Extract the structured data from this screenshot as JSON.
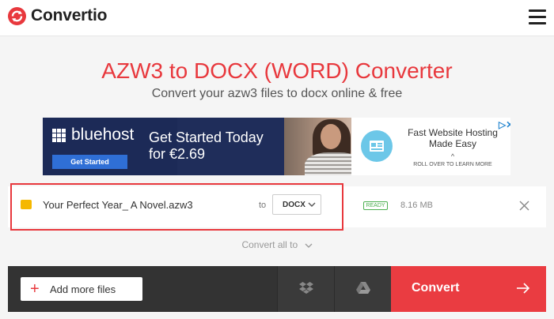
{
  "header": {
    "brand_name": "Convertio",
    "menu_icon": "hamburger-menu-icon"
  },
  "hero": {
    "title": "AZW3 to DOCX (WORD) Converter",
    "subtitle": "Convert your azw3 files to docx online & free"
  },
  "ad": {
    "brand": "bluehost",
    "button_label": "Get Started",
    "headline": "Get Started Today for €2.69",
    "right_text": "Fast Website Hosting Made Easy",
    "rollover_text": "ROLL OVER TO LEARN MORE",
    "adchoices_icon": "adchoices-icon"
  },
  "file": {
    "name": "Your Perfect Year_ A Novel.azw3",
    "to_label": "to",
    "target_format": "DOCX",
    "status": "READY",
    "size": "8.16 MB"
  },
  "convert_all_label": "Convert all to",
  "toolbar": {
    "add_files_label": "Add more files",
    "convert_label": "Convert"
  },
  "colors": {
    "accent": "#e8383d",
    "bar": "#333333",
    "ready": "#4caf50"
  }
}
